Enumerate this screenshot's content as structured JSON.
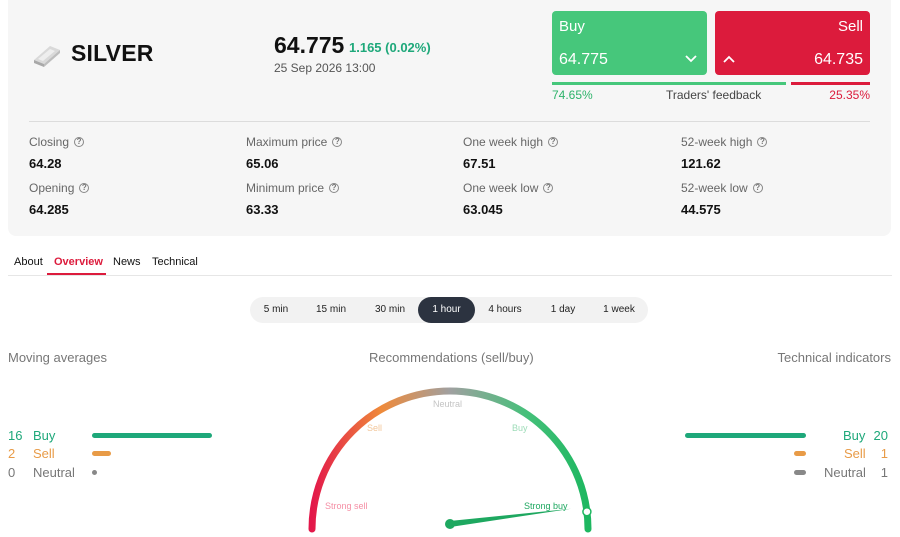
{
  "asset": {
    "name": "SILVER",
    "icon": "silver-bar-icon"
  },
  "quote": {
    "price": "64.775",
    "change": "1.165 (0.02%)",
    "datetime": "25 Sep 2026 13:00"
  },
  "trade": {
    "buy": {
      "label": "Buy",
      "price": "64.775",
      "icon": "chevron-down-icon"
    },
    "sell": {
      "label": "Sell",
      "price": "64.735",
      "icon": "chevron-up-icon"
    }
  },
  "feedback": {
    "label": "Traders' feedback",
    "buy_pct": "74.65%",
    "sell_pct": "25.35%",
    "buy_fraction": 0.7465
  },
  "stats": [
    {
      "label": "Closing",
      "value": "64.28"
    },
    {
      "label": "Maximum price",
      "value": "65.06"
    },
    {
      "label": "One week high",
      "value": "67.51"
    },
    {
      "label": "52-week high",
      "value": "121.62"
    },
    {
      "label": "Opening",
      "value": "64.285"
    },
    {
      "label": "Minimum price",
      "value": "63.33"
    },
    {
      "label": "One week low",
      "value": "63.045"
    },
    {
      "label": "52-week low",
      "value": "44.575"
    }
  ],
  "tabs": [
    {
      "label": "About"
    },
    {
      "label": "Overview",
      "active": true
    },
    {
      "label": "News"
    },
    {
      "label": "Technical"
    }
  ],
  "periods": [
    "5 min",
    "15 min",
    "30 min",
    "1 hour",
    "4 hours",
    "1 day",
    "1 week"
  ],
  "active_period": "1 hour",
  "moving_averages": {
    "title": "Moving averages",
    "buy": {
      "count": "16",
      "label": "Buy"
    },
    "sell": {
      "count": "2",
      "label": "Sell"
    },
    "neutral": {
      "count": "0",
      "label": "Neutral"
    }
  },
  "recommendations": {
    "title": "Recommendations (sell/buy)",
    "labels": {
      "strong_sell": "Strong sell",
      "sell": "Sell",
      "neutral": "Neutral",
      "buy": "Buy",
      "strong_buy": "Strong buy"
    },
    "needle_level": 0.96
  },
  "technical_indicators": {
    "title": "Technical indicators",
    "buy": {
      "count": "20",
      "label": "Buy"
    },
    "sell": {
      "count": "1",
      "label": "Sell"
    },
    "neutral": {
      "count": "1",
      "label": "Neutral"
    }
  },
  "colors": {
    "buy": "#46c77b",
    "sell": "#dc1b3c",
    "ind_buy": "#1ea87a",
    "ind_sell": "#e89b47",
    "neutral": "#888888"
  }
}
